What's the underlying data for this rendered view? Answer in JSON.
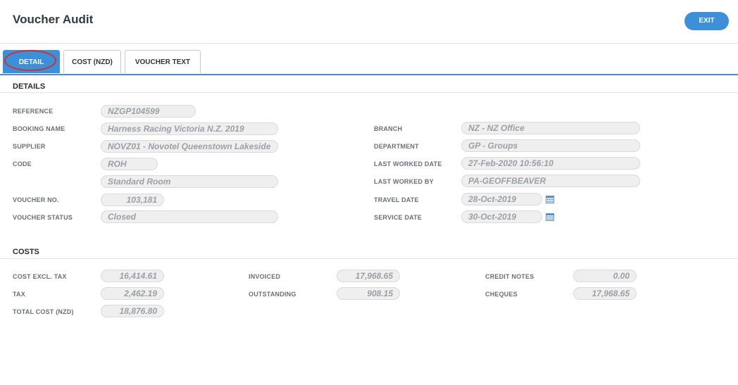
{
  "header": {
    "title": "Voucher Audit",
    "exit_label": "EXIT"
  },
  "tabs": [
    "DETAIL",
    "COST (NZD)",
    "VOUCHER TEXT"
  ],
  "details": {
    "section_title": "DETAILS",
    "reference": {
      "label": "REFERENCE",
      "value": "NZGP104599"
    },
    "booking_name": {
      "label": "BOOKING NAME",
      "value": "Harness Racing Victoria N.Z. 2019"
    },
    "supplier": {
      "label": "SUPPLIER",
      "value": "NOVZ01 - Novotel Queenstown Lakeside"
    },
    "code": {
      "label": "CODE",
      "value": "ROH",
      "description": "Standard Room"
    },
    "voucher_no": {
      "label": "VOUCHER NO.",
      "value": "103,181"
    },
    "voucher_status": {
      "label": "VOUCHER STATUS",
      "value": "Closed"
    },
    "branch": {
      "label": "BRANCH",
      "value": "NZ - NZ Office"
    },
    "department": {
      "label": "DEPARTMENT",
      "value": "GP - Groups"
    },
    "last_worked_date": {
      "label": "LAST WORKED DATE",
      "value": "27-Feb-2020 10:56:10"
    },
    "last_worked_by": {
      "label": "LAST WORKED BY",
      "value": "PA-GEOFFBEAVER"
    },
    "travel_date": {
      "label": "TRAVEL DATE",
      "value": "28-Oct-2019"
    },
    "service_date": {
      "label": "SERVICE DATE",
      "value": "30-Oct-2019"
    }
  },
  "costs": {
    "section_title": "COSTS",
    "cost_excl_tax": {
      "label": "COST EXCL. TAX",
      "value": "16,414.61"
    },
    "tax": {
      "label": "TAX",
      "value": "2,462.19"
    },
    "total_cost": {
      "label": "TOTAL COST (NZD)",
      "value": "18,876.80"
    },
    "invoiced": {
      "label": "INVOICED",
      "value": "17,968.65"
    },
    "outstanding": {
      "label": "OUTSTANDING",
      "value": "908.15"
    },
    "credit_notes": {
      "label": "CREDIT NOTES",
      "value": "0.00"
    },
    "cheques": {
      "label": "CHEQUES",
      "value": "17,968.65"
    }
  },
  "colors": {
    "accent": "#3d8fd8",
    "highlight_ring": "#d03030",
    "field_bg": "#efefef"
  }
}
